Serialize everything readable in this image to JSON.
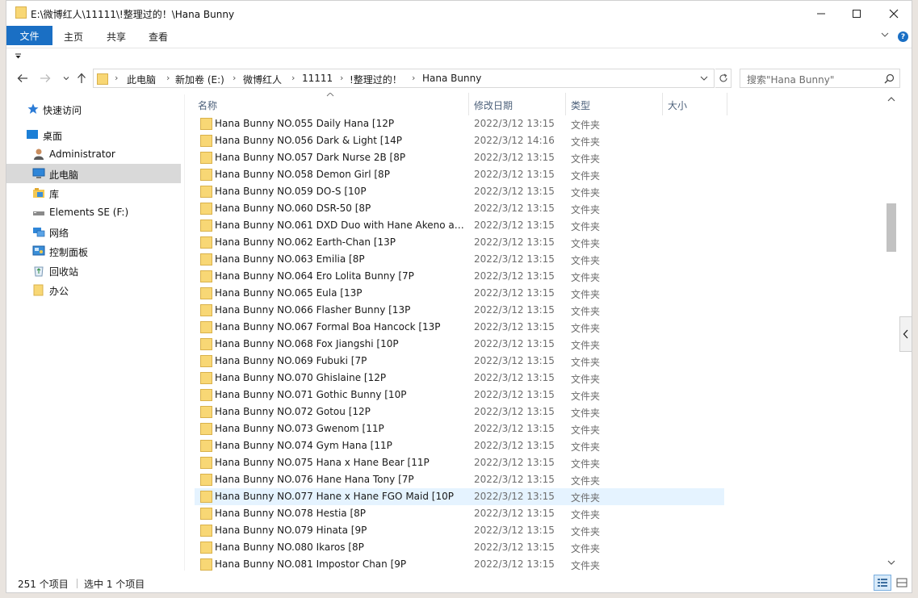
{
  "window": {
    "title": "E:\\微博红人\\11111\\!整理过的！\\Hana Bunny"
  },
  "ribbon": {
    "file_tab": "文件",
    "tabs": [
      "主页",
      "共享",
      "查看"
    ]
  },
  "address": {
    "crumbs": [
      "此电脑",
      "新加卷 (E:)",
      "微博红人",
      "11111",
      "!整理过的！",
      "Hana Bunny"
    ],
    "search_placeholder": "搜索\"Hana Bunny\""
  },
  "sidebar": {
    "items": [
      {
        "label": "快速访问",
        "icon": "star-icon"
      },
      {
        "label": "桌面",
        "icon": "desktop-icon"
      },
      {
        "label": "Administrator",
        "icon": "user-icon"
      },
      {
        "label": "此电脑",
        "icon": "computer-icon",
        "selected": true
      },
      {
        "label": "库",
        "icon": "library-icon"
      },
      {
        "label": "Elements SE (F:)",
        "icon": "drive-icon"
      },
      {
        "label": "网络",
        "icon": "network-icon"
      },
      {
        "label": "控制面板",
        "icon": "control-panel-icon"
      },
      {
        "label": "回收站",
        "icon": "recycle-bin-icon"
      },
      {
        "label": "办公",
        "icon": "folder-icon"
      }
    ]
  },
  "columns": {
    "name": "名称",
    "date": "修改日期",
    "type": "类型",
    "size": "大小"
  },
  "files": [
    {
      "name": "Hana Bunny NO.055 Daily Hana [12P",
      "date": "2022/3/12 13:15",
      "type": "文件夹"
    },
    {
      "name": "Hana Bunny NO.056 Dark & Light [14P",
      "date": "2022/3/12 14:16",
      "type": "文件夹"
    },
    {
      "name": "Hana Bunny NO.057 Dark Nurse 2B [8P",
      "date": "2022/3/12 13:15",
      "type": "文件夹"
    },
    {
      "name": "Hana Bunny NO.058 Demon Girl [8P",
      "date": "2022/3/12 13:15",
      "type": "文件夹"
    },
    {
      "name": "Hana Bunny NO.059 DO-S [10P",
      "date": "2022/3/12 13:15",
      "type": "文件夹"
    },
    {
      "name": "Hana Bunny NO.060 DSR-50 [8P",
      "date": "2022/3/12 13:15",
      "type": "文件夹"
    },
    {
      "name": "Hana Bunny NO.061 DXD Duo with Hane Akeno an...",
      "date": "2022/3/12 13:15",
      "type": "文件夹"
    },
    {
      "name": "Hana Bunny NO.062 Earth-Chan [13P",
      "date": "2022/3/12 13:15",
      "type": "文件夹"
    },
    {
      "name": "Hana Bunny NO.063 Emilia [8P",
      "date": "2022/3/12 13:15",
      "type": "文件夹"
    },
    {
      "name": "Hana Bunny NO.064 Ero Lolita Bunny [7P",
      "date": "2022/3/12 13:15",
      "type": "文件夹"
    },
    {
      "name": "Hana Bunny NO.065 Eula [13P",
      "date": "2022/3/12 13:15",
      "type": "文件夹"
    },
    {
      "name": "Hana Bunny NO.066 Flasher Bunny [13P",
      "date": "2022/3/12 13:15",
      "type": "文件夹"
    },
    {
      "name": "Hana Bunny NO.067 Formal Boa Hancock [13P",
      "date": "2022/3/12 13:15",
      "type": "文件夹"
    },
    {
      "name": "Hana Bunny NO.068 Fox Jiangshi [10P",
      "date": "2022/3/12 13:15",
      "type": "文件夹"
    },
    {
      "name": "Hana Bunny NO.069 Fubuki [7P",
      "date": "2022/3/12 13:15",
      "type": "文件夹"
    },
    {
      "name": "Hana Bunny NO.070 Ghislaine [12P",
      "date": "2022/3/12 13:15",
      "type": "文件夹"
    },
    {
      "name": "Hana Bunny NO.071 Gothic Bunny [10P",
      "date": "2022/3/12 13:15",
      "type": "文件夹"
    },
    {
      "name": "Hana Bunny NO.072 Gotou [12P",
      "date": "2022/3/12 13:15",
      "type": "文件夹"
    },
    {
      "name": "Hana Bunny NO.073 Gwenom [11P",
      "date": "2022/3/12 13:15",
      "type": "文件夹"
    },
    {
      "name": "Hana Bunny NO.074 Gym Hana [11P",
      "date": "2022/3/12 13:15",
      "type": "文件夹"
    },
    {
      "name": "Hana Bunny NO.075 Hana x Hane Bear [11P",
      "date": "2022/3/12 13:15",
      "type": "文件夹"
    },
    {
      "name": "Hana Bunny NO.076 Hane Hana Tony [7P",
      "date": "2022/3/12 13:15",
      "type": "文件夹"
    },
    {
      "name": "Hana Bunny NO.077 Hane x Hane FGO Maid [10P",
      "date": "2022/3/12 13:15",
      "type": "文件夹",
      "selected": true
    },
    {
      "name": "Hana Bunny NO.078 Hestia [8P",
      "date": "2022/3/12 13:15",
      "type": "文件夹"
    },
    {
      "name": "Hana Bunny NO.079 Hinata [9P",
      "date": "2022/3/12 13:15",
      "type": "文件夹"
    },
    {
      "name": "Hana Bunny NO.080 Ikaros [8P",
      "date": "2022/3/12 13:15",
      "type": "文件夹"
    },
    {
      "name": "Hana Bunny NO.081 Impostor Chan [9P",
      "date": "2022/3/12 13:15",
      "type": "文件夹"
    }
  ],
  "status": {
    "item_count": "251 个项目",
    "selected": "选中 1 个项目"
  },
  "colors": {
    "accent": "#1a6fc4",
    "selection_row": "#e5f3ff",
    "folder_yellow": "#f8d775"
  }
}
